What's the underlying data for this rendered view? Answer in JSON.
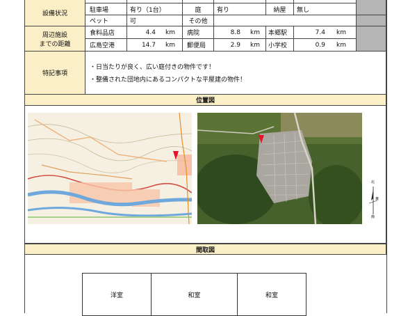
{
  "equipment": {
    "section_label": "設備状況",
    "row0": [
      "",
      "",
      "",
      "",
      "",
      "",
      "",
      ""
    ],
    "row1": {
      "parking_label": "駐車場",
      "parking_value": "有り（1台）",
      "garden_label": "庭",
      "garden_value": "有り",
      "shed_label": "納屋",
      "shed_value": "無し"
    },
    "row2": {
      "pet_label": "ペット",
      "pet_value": "可",
      "other_label": "その他",
      "other_value": ""
    }
  },
  "nearby": {
    "section_label_line1": "周辺施設",
    "section_label_line2": "までの距離",
    "rows": [
      [
        {
          "name": "食料品店",
          "value": "4.4",
          "unit": "km"
        },
        {
          "name": "病院",
          "value": "8.8",
          "unit": "km"
        },
        {
          "name": "本郷駅",
          "value": "7.4",
          "unit": "km"
        }
      ],
      [
        {
          "name": "広島空港",
          "value": "14.7",
          "unit": "km"
        },
        {
          "name": "郵便局",
          "value": "2.9",
          "unit": "km"
        },
        {
          "name": "小学校",
          "value": "0.9",
          "unit": "km"
        }
      ]
    ]
  },
  "remarks": {
    "label": "特記事項",
    "bullets": [
      "・日当たりが良く、広い庭付きの物件です！",
      "・整備された団地内にあるコンパクトな平屋建の物件！"
    ]
  },
  "location": {
    "title": "位置図",
    "compass_n": "北",
    "compass_s": "南",
    "compass_e": "東"
  },
  "floorplan": {
    "title": "間取図",
    "rooms": [
      "洋室",
      "和室",
      "和室"
    ]
  },
  "colors": {
    "header_bg": "#fbefc7",
    "gray_cell": "#b5b5b5",
    "marker": "#e8102a"
  }
}
